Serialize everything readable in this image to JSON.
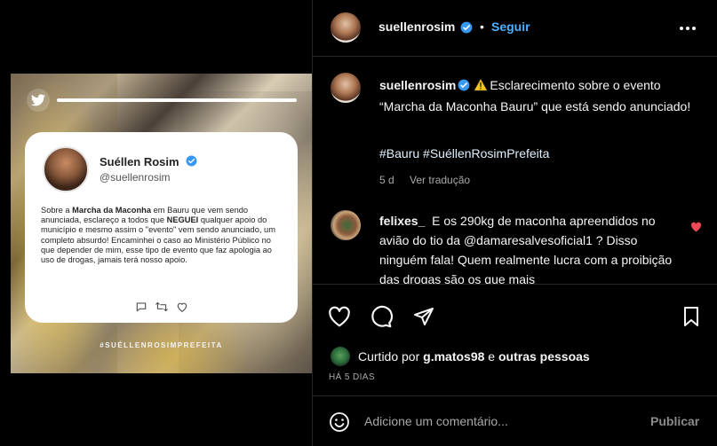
{
  "tweet_card": {
    "name": "Suéllen Rosim",
    "handle": "@suellenrosim",
    "body_1": "Sobre a ",
    "body_bold_1": "Marcha da Maconha",
    "body_2": " em Bauru que vem sendo anunciada, esclareço a todos que ",
    "body_bold_2": "NEGUEI",
    "body_3": " qualquer apoio do município e mesmo assim o \"evento\" vem sendo anunciado, um completo absurdo! Encaminhei o caso ao Ministério Público no que depender de mim, esse tipo de evento que faz apologia ao uso de drogas, jamais terá nosso apoio.",
    "footer_hashtag": "#SUÉLLENROSIMPREFEITA"
  },
  "header": {
    "username": "suellenrosim",
    "dot": "•",
    "follow_label": "Seguir"
  },
  "caption": {
    "username": "suellenrosim",
    "text": "Esclarecimento sobre o evento “Marcha da Maconha Bauru” que está sendo anunciado!",
    "hashtags": "#Bauru #SuéllenRosimPrefeita",
    "age": "5 d",
    "translate_label": "Ver tradução"
  },
  "comment": {
    "username": "felixes_",
    "text": "E os 290kg de maconha apreendidos no avião do tio da @damaresalvesoficial1 ? Disso ninguém fala! Quem realmente lucra com a proibição das drogas são os que mais"
  },
  "likes": {
    "prefix": "Curtido por",
    "user": "g.matos98",
    "conjunction": "e",
    "others": "outras pessoas"
  },
  "posted_time": "HÁ 5 DIAS",
  "add_comment": {
    "placeholder": "Adicione um comentário...",
    "post_label": "Publicar"
  },
  "colors": {
    "accent": "#4fb0ff",
    "heart": "#ed4956",
    "verified": "#3897f0",
    "warning": "#f5c518"
  }
}
